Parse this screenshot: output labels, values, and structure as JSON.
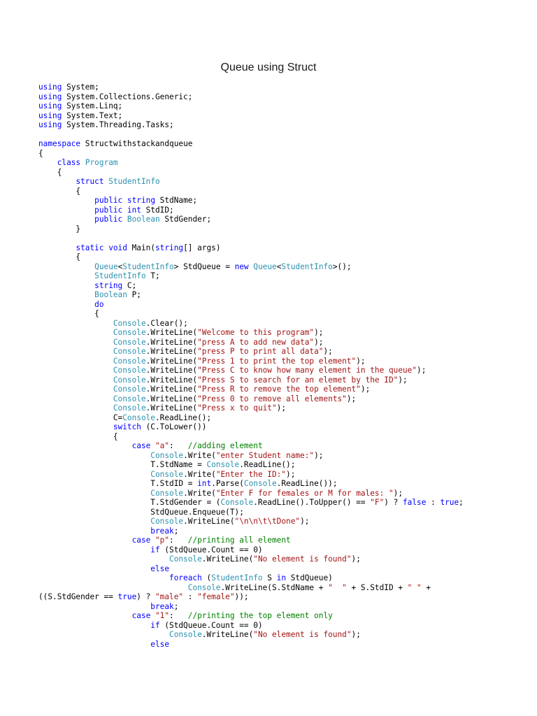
{
  "document": {
    "title": "Queue using Struct"
  },
  "colors": {
    "text": "#000000",
    "keyword": "#0000ff",
    "type": "#2b91af",
    "string": "#a31515",
    "comment": "#008000"
  },
  "code": {
    "lines": [
      [
        [
          "k",
          "using"
        ],
        [
          "t",
          " System;"
        ]
      ],
      [
        [
          "k",
          "using"
        ],
        [
          "t",
          " System.Collections.Generic;"
        ]
      ],
      [
        [
          "k",
          "using"
        ],
        [
          "t",
          " System.Linq;"
        ]
      ],
      [
        [
          "k",
          "using"
        ],
        [
          "t",
          " System.Text;"
        ]
      ],
      [
        [
          "k",
          "using"
        ],
        [
          "t",
          " System.Threading.Tasks;"
        ]
      ],
      [],
      [
        [
          "k",
          "namespace"
        ],
        [
          "t",
          " Structwithstackandqueue"
        ]
      ],
      [
        [
          "t",
          "{"
        ]
      ],
      [
        [
          "t",
          "    "
        ],
        [
          "k",
          "class"
        ],
        [
          "t",
          " "
        ],
        [
          "y",
          "Program"
        ]
      ],
      [
        [
          "t",
          "    {"
        ]
      ],
      [
        [
          "t",
          "        "
        ],
        [
          "k",
          "struct"
        ],
        [
          "t",
          " "
        ],
        [
          "y",
          "StudentInfo"
        ]
      ],
      [
        [
          "t",
          "        {"
        ]
      ],
      [
        [
          "t",
          "            "
        ],
        [
          "k",
          "public"
        ],
        [
          "t",
          " "
        ],
        [
          "k",
          "string"
        ],
        [
          "t",
          " StdName;"
        ]
      ],
      [
        [
          "t",
          "            "
        ],
        [
          "k",
          "public"
        ],
        [
          "t",
          " "
        ],
        [
          "k",
          "int"
        ],
        [
          "t",
          " StdID;"
        ]
      ],
      [
        [
          "t",
          "            "
        ],
        [
          "k",
          "public"
        ],
        [
          "t",
          " "
        ],
        [
          "y",
          "Boolean"
        ],
        [
          "t",
          " StdGender;"
        ]
      ],
      [
        [
          "t",
          "        }"
        ]
      ],
      [],
      [
        [
          "t",
          "        "
        ],
        [
          "k",
          "static"
        ],
        [
          "t",
          " "
        ],
        [
          "k",
          "void"
        ],
        [
          "t",
          " Main("
        ],
        [
          "k",
          "string"
        ],
        [
          "t",
          "[] args)"
        ]
      ],
      [
        [
          "t",
          "        {"
        ]
      ],
      [
        [
          "t",
          "            "
        ],
        [
          "y",
          "Queue"
        ],
        [
          "t",
          "<"
        ],
        [
          "y",
          "StudentInfo"
        ],
        [
          "t",
          "> StdQueue = "
        ],
        [
          "k",
          "new"
        ],
        [
          "t",
          " "
        ],
        [
          "y",
          "Queue"
        ],
        [
          "t",
          "<"
        ],
        [
          "y",
          "StudentInfo"
        ],
        [
          "t",
          ">();"
        ]
      ],
      [
        [
          "t",
          "            "
        ],
        [
          "y",
          "StudentInfo"
        ],
        [
          "t",
          " T;"
        ]
      ],
      [
        [
          "t",
          "            "
        ],
        [
          "k",
          "string"
        ],
        [
          "t",
          " C;"
        ]
      ],
      [
        [
          "t",
          "            "
        ],
        [
          "y",
          "Boolean"
        ],
        [
          "t",
          " P;"
        ]
      ],
      [
        [
          "t",
          "            "
        ],
        [
          "k",
          "do"
        ]
      ],
      [
        [
          "t",
          "            {"
        ]
      ],
      [
        [
          "t",
          "                "
        ],
        [
          "y",
          "Console"
        ],
        [
          "t",
          ".Clear();"
        ]
      ],
      [
        [
          "t",
          "                "
        ],
        [
          "y",
          "Console"
        ],
        [
          "t",
          ".WriteLine("
        ],
        [
          "s",
          "\"Welcome to this program\""
        ],
        [
          "t",
          ");"
        ]
      ],
      [
        [
          "t",
          "                "
        ],
        [
          "y",
          "Console"
        ],
        [
          "t",
          ".WriteLine("
        ],
        [
          "s",
          "\"press A to add new data\""
        ],
        [
          "t",
          ");"
        ]
      ],
      [
        [
          "t",
          "                "
        ],
        [
          "y",
          "Console"
        ],
        [
          "t",
          ".WriteLine("
        ],
        [
          "s",
          "\"press P to print all data\""
        ],
        [
          "t",
          ");"
        ]
      ],
      [
        [
          "t",
          "                "
        ],
        [
          "y",
          "Console"
        ],
        [
          "t",
          ".WriteLine("
        ],
        [
          "s",
          "\"Press 1 to print the top element\""
        ],
        [
          "t",
          ");"
        ]
      ],
      [
        [
          "t",
          "                "
        ],
        [
          "y",
          "Console"
        ],
        [
          "t",
          ".WriteLine("
        ],
        [
          "s",
          "\"Press C to know how many element in the queue\""
        ],
        [
          "t",
          ");"
        ]
      ],
      [
        [
          "t",
          "                "
        ],
        [
          "y",
          "Console"
        ],
        [
          "t",
          ".WriteLine("
        ],
        [
          "s",
          "\"Press S to search for an elemet by the ID\""
        ],
        [
          "t",
          ");"
        ]
      ],
      [
        [
          "t",
          "                "
        ],
        [
          "y",
          "Console"
        ],
        [
          "t",
          ".WriteLine("
        ],
        [
          "s",
          "\"Press R to remove the top element\""
        ],
        [
          "t",
          ");"
        ]
      ],
      [
        [
          "t",
          "                "
        ],
        [
          "y",
          "Console"
        ],
        [
          "t",
          ".WriteLine("
        ],
        [
          "s",
          "\"Press 0 to remove all elements\""
        ],
        [
          "t",
          ");"
        ]
      ],
      [
        [
          "t",
          "                "
        ],
        [
          "y",
          "Console"
        ],
        [
          "t",
          ".WriteLine("
        ],
        [
          "s",
          "\"Press x to quit\""
        ],
        [
          "t",
          ");"
        ]
      ],
      [
        [
          "t",
          "                C="
        ],
        [
          "y",
          "Console"
        ],
        [
          "t",
          ".ReadLine();"
        ]
      ],
      [
        [
          "t",
          "                "
        ],
        [
          "k",
          "switch"
        ],
        [
          "t",
          " (C.ToLower())"
        ]
      ],
      [
        [
          "t",
          "                {"
        ]
      ],
      [
        [
          "t",
          "                    "
        ],
        [
          "k",
          "case"
        ],
        [
          "t",
          " "
        ],
        [
          "s",
          "\"a\""
        ],
        [
          "t",
          ":   "
        ],
        [
          "c",
          "//adding element"
        ]
      ],
      [
        [
          "t",
          "                        "
        ],
        [
          "y",
          "Console"
        ],
        [
          "t",
          ".Write("
        ],
        [
          "s",
          "\"enter Student name:\""
        ],
        [
          "t",
          ");"
        ]
      ],
      [
        [
          "t",
          "                        T.StdName = "
        ],
        [
          "y",
          "Console"
        ],
        [
          "t",
          ".ReadLine();"
        ]
      ],
      [
        [
          "t",
          "                        "
        ],
        [
          "y",
          "Console"
        ],
        [
          "t",
          ".Write("
        ],
        [
          "s",
          "\"Enter the ID:\""
        ],
        [
          "t",
          ");"
        ]
      ],
      [
        [
          "t",
          "                        T.StdID = "
        ],
        [
          "k",
          "int"
        ],
        [
          "t",
          ".Parse("
        ],
        [
          "y",
          "Console"
        ],
        [
          "t",
          ".ReadLine());"
        ]
      ],
      [
        [
          "t",
          "                        "
        ],
        [
          "y",
          "Console"
        ],
        [
          "t",
          ".Write("
        ],
        [
          "s",
          "\"Enter F for females or M for males: \""
        ],
        [
          "t",
          ");"
        ]
      ],
      [
        [
          "t",
          "                        T.StdGender = ("
        ],
        [
          "y",
          "Console"
        ],
        [
          "t",
          ".ReadLine().ToUpper() == "
        ],
        [
          "s",
          "\"F\""
        ],
        [
          "t",
          ") ? "
        ],
        [
          "k",
          "false"
        ],
        [
          "t",
          " : "
        ],
        [
          "k",
          "true"
        ],
        [
          "t",
          ";"
        ]
      ],
      [
        [
          "t",
          "                        StdQueue.Enqueue(T);"
        ]
      ],
      [
        [
          "t",
          "                        "
        ],
        [
          "y",
          "Console"
        ],
        [
          "t",
          ".WriteLine("
        ],
        [
          "s",
          "\"\\n\\n\\t\\tDone\""
        ],
        [
          "t",
          ");"
        ]
      ],
      [
        [
          "t",
          "                        "
        ],
        [
          "k",
          "break"
        ],
        [
          "t",
          ";"
        ]
      ],
      [
        [
          "t",
          "                    "
        ],
        [
          "k",
          "case"
        ],
        [
          "t",
          " "
        ],
        [
          "s",
          "\"p\""
        ],
        [
          "t",
          ":   "
        ],
        [
          "c",
          "//printing all element"
        ]
      ],
      [
        [
          "t",
          "                        "
        ],
        [
          "k",
          "if"
        ],
        [
          "t",
          " (StdQueue.Count == 0)"
        ]
      ],
      [
        [
          "t",
          "                            "
        ],
        [
          "y",
          "Console"
        ],
        [
          "t",
          ".WriteLine("
        ],
        [
          "s",
          "\"No element is found\""
        ],
        [
          "t",
          ");"
        ]
      ],
      [
        [
          "t",
          "                        "
        ],
        [
          "k",
          "else"
        ]
      ],
      [
        [
          "t",
          "                            "
        ],
        [
          "k",
          "foreach"
        ],
        [
          "t",
          " ("
        ],
        [
          "y",
          "StudentInfo"
        ],
        [
          "t",
          " S "
        ],
        [
          "k",
          "in"
        ],
        [
          "t",
          " StdQueue)"
        ]
      ],
      [
        [
          "t",
          "                                "
        ],
        [
          "y",
          "Console"
        ],
        [
          "t",
          ".WriteLine(S.StdName + "
        ],
        [
          "s",
          "\"  \""
        ],
        [
          "t",
          " + S.StdID + "
        ],
        [
          "s",
          "\" \""
        ],
        [
          "t",
          " +"
        ]
      ],
      [
        [
          "t",
          "((S.StdGender == "
        ],
        [
          "k",
          "true"
        ],
        [
          "t",
          ") ? "
        ],
        [
          "s",
          "\"male\""
        ],
        [
          "t",
          " : "
        ],
        [
          "s",
          "\"female\""
        ],
        [
          "t",
          "));"
        ]
      ],
      [
        [
          "t",
          "                        "
        ],
        [
          "k",
          "break"
        ],
        [
          "t",
          ";"
        ]
      ],
      [
        [
          "t",
          "                    "
        ],
        [
          "k",
          "case"
        ],
        [
          "t",
          " "
        ],
        [
          "s",
          "\"1\""
        ],
        [
          "t",
          ":   "
        ],
        [
          "c",
          "//printing the top element only"
        ]
      ],
      [
        [
          "t",
          "                        "
        ],
        [
          "k",
          "if"
        ],
        [
          "t",
          " (StdQueue.Count == 0)"
        ]
      ],
      [
        [
          "t",
          "                            "
        ],
        [
          "y",
          "Console"
        ],
        [
          "t",
          ".WriteLine("
        ],
        [
          "s",
          "\"No element is found\""
        ],
        [
          "t",
          ");"
        ]
      ],
      [
        [
          "t",
          "                        "
        ],
        [
          "k",
          "else"
        ]
      ]
    ]
  }
}
